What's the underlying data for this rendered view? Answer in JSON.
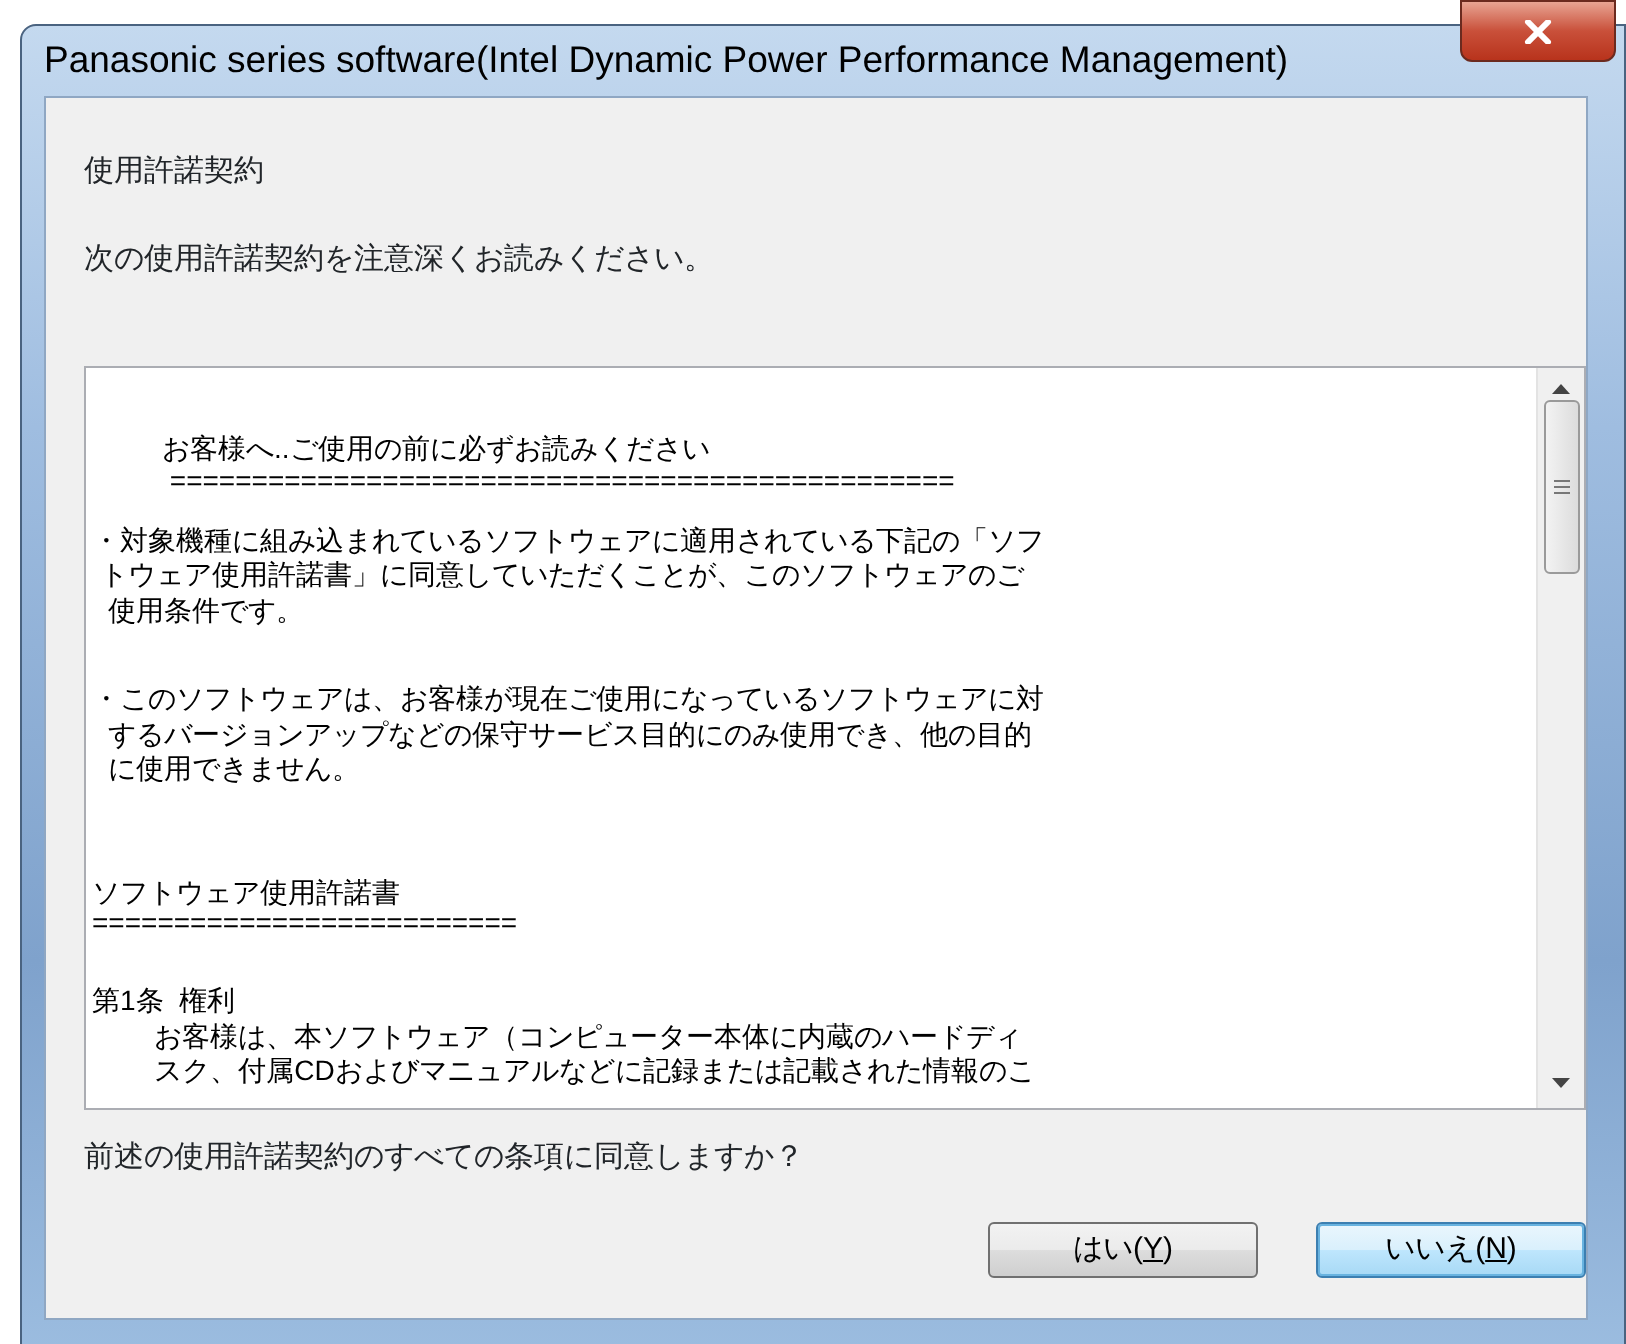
{
  "window": {
    "title": "Panasonic series software(Intel Dynamic Power Performance Management)"
  },
  "heading": "使用許諾契約",
  "instruction": "次の使用許諾契約を注意深くお読みください。",
  "license_text": [
    {
      "kind": "heading",
      "text": "         お客様へ..ご使用の前に必ずお読みください"
    },
    {
      "kind": "rule",
      "text": "          ================================================"
    },
    {
      "kind": "bullet",
      "lines": [
        "・対象機種に組み込まれているソフトウェアに適用されている下記の「ソフ",
        " トウェア使用許諾書」に同意していただくことが、このソフトウェアのご",
        "  使用条件です。"
      ]
    },
    {
      "kind": "bullet",
      "lines": [
        "・このソフトウェアは、お客様が現在ご使用になっているソフトウェアに対",
        "  するバージョンアップなどの保守サービス目的にのみ使用でき、他の目的",
        "  に使用できません。"
      ]
    },
    {
      "kind": "section",
      "text": "ソフトウェア使用許諾書"
    },
    {
      "kind": "rule",
      "text": "=========================="
    },
    {
      "kind": "clause",
      "lines": [
        "第1条  権利",
        "        お客様は、本ソフトウェア（コンピューター本体に内蔵のハードディ",
        "        スク、付属CDおよびマニュアルなどに記録または記載された情報のこ"
      ]
    }
  ],
  "question": "前述の使用許諾契約のすべての条項に同意しますか？",
  "buttons": [
    {
      "text_before": "はい(",
      "access_key": "Y",
      "text_after": ")",
      "default": false
    },
    {
      "text_before": "いいえ(",
      "access_key": "N",
      "text_after": ")",
      "default": true
    }
  ]
}
